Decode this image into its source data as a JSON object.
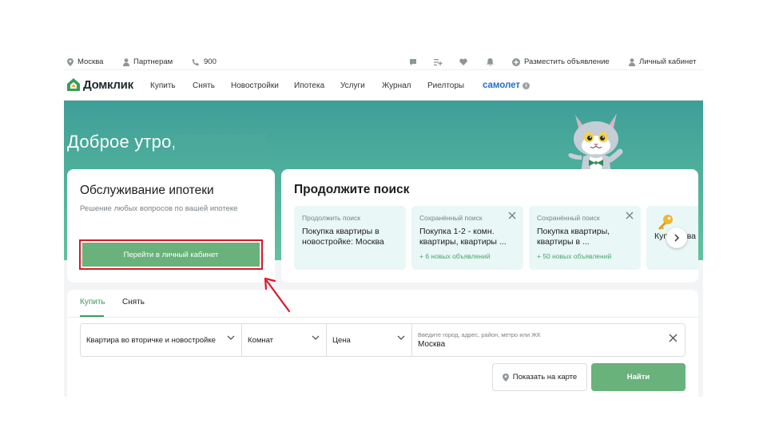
{
  "topbar": {
    "city": "Москва",
    "partners": "Партнерам",
    "phone": "900",
    "post_ad": "Разместить объявление",
    "cabinet": "Личный кабинет"
  },
  "nav": {
    "logo": "Домклик",
    "links": [
      "Купить",
      "Снять",
      "Новостройки",
      "Ипотека",
      "Услуги",
      "Журнал",
      "Риелторы"
    ],
    "partner_brand": "самолет",
    "info_mark": "i"
  },
  "hero": {
    "greeting": "Доброе утро,"
  },
  "mortgage_card": {
    "title": "Обслуживание ипотеки",
    "subtitle": "Решение любых вопросов по вашей ипотеке",
    "button": "Перейти в личный кабинет"
  },
  "continue_search": {
    "title": "Продолжите поиск",
    "tiles": [
      {
        "label": "Продолжить поиск",
        "text": "Покупка квартиры в новостройке: Москва",
        "new": ""
      },
      {
        "label": "Сохранённый поиск",
        "text": "Покупка 1-2 - комн. квартиры, квартиры ...",
        "new": "+ 6 новых объявлений"
      },
      {
        "label": "Сохранённый поиск",
        "text": "Покупка квартиры, квартиры в ...",
        "new": "+ 50 новых объявлений"
      }
    ],
    "key_tile_text": "Купить ква"
  },
  "search_form": {
    "tabs": [
      "Купить",
      "Снять"
    ],
    "property_type": "Квартира во вторичке и новостройке",
    "rooms": "Комнат",
    "price": "Цена",
    "location_placeholder": "Введите город, адрес, район, метро или ЖК",
    "location_value": "Москва",
    "map_button": "Показать на карте",
    "find_button": "Найти"
  },
  "colors": {
    "brand_green": "#6ab27b",
    "accent_green_text": "#3d9b5c",
    "hero_teal": "#3f9e99",
    "tile_bg": "#e9f7f6",
    "highlight_red": "#d8192a",
    "samolet_blue": "#1f6fd1"
  }
}
